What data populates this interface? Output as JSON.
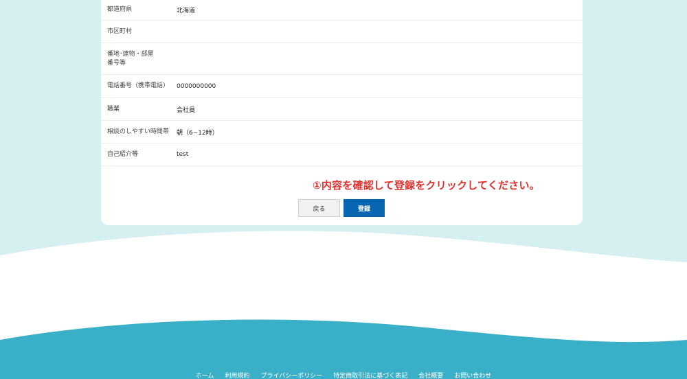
{
  "form": {
    "rows": [
      {
        "label": "都道府県",
        "value": "北海道"
      },
      {
        "label": "市区町村",
        "value": ""
      },
      {
        "label": "番地･建物・部屋番号等",
        "value": ""
      },
      {
        "label": "電話番号（携帯電話）",
        "value": "0000000000"
      },
      {
        "label": "職業",
        "value": "会社員"
      },
      {
        "label": "相談のしやすい時間帯",
        "value": "朝（6~12時）"
      },
      {
        "label": "自己紹介等",
        "value": "test"
      }
    ]
  },
  "notice": "①内容を確認して登録をクリックしてください。",
  "buttons": {
    "back": "戻る",
    "submit": "登録"
  },
  "footer": {
    "links": [
      "ホーム",
      "利用規約",
      "プライバシーポリシー",
      "特定商取引法に基づく表記",
      "会社概要",
      "お問い合わせ"
    ]
  },
  "colors": {
    "bg_light": "#d6eff0",
    "wave_dark": "#3ab0c8",
    "notice": "#e0312d",
    "primary": "#0765b1"
  }
}
